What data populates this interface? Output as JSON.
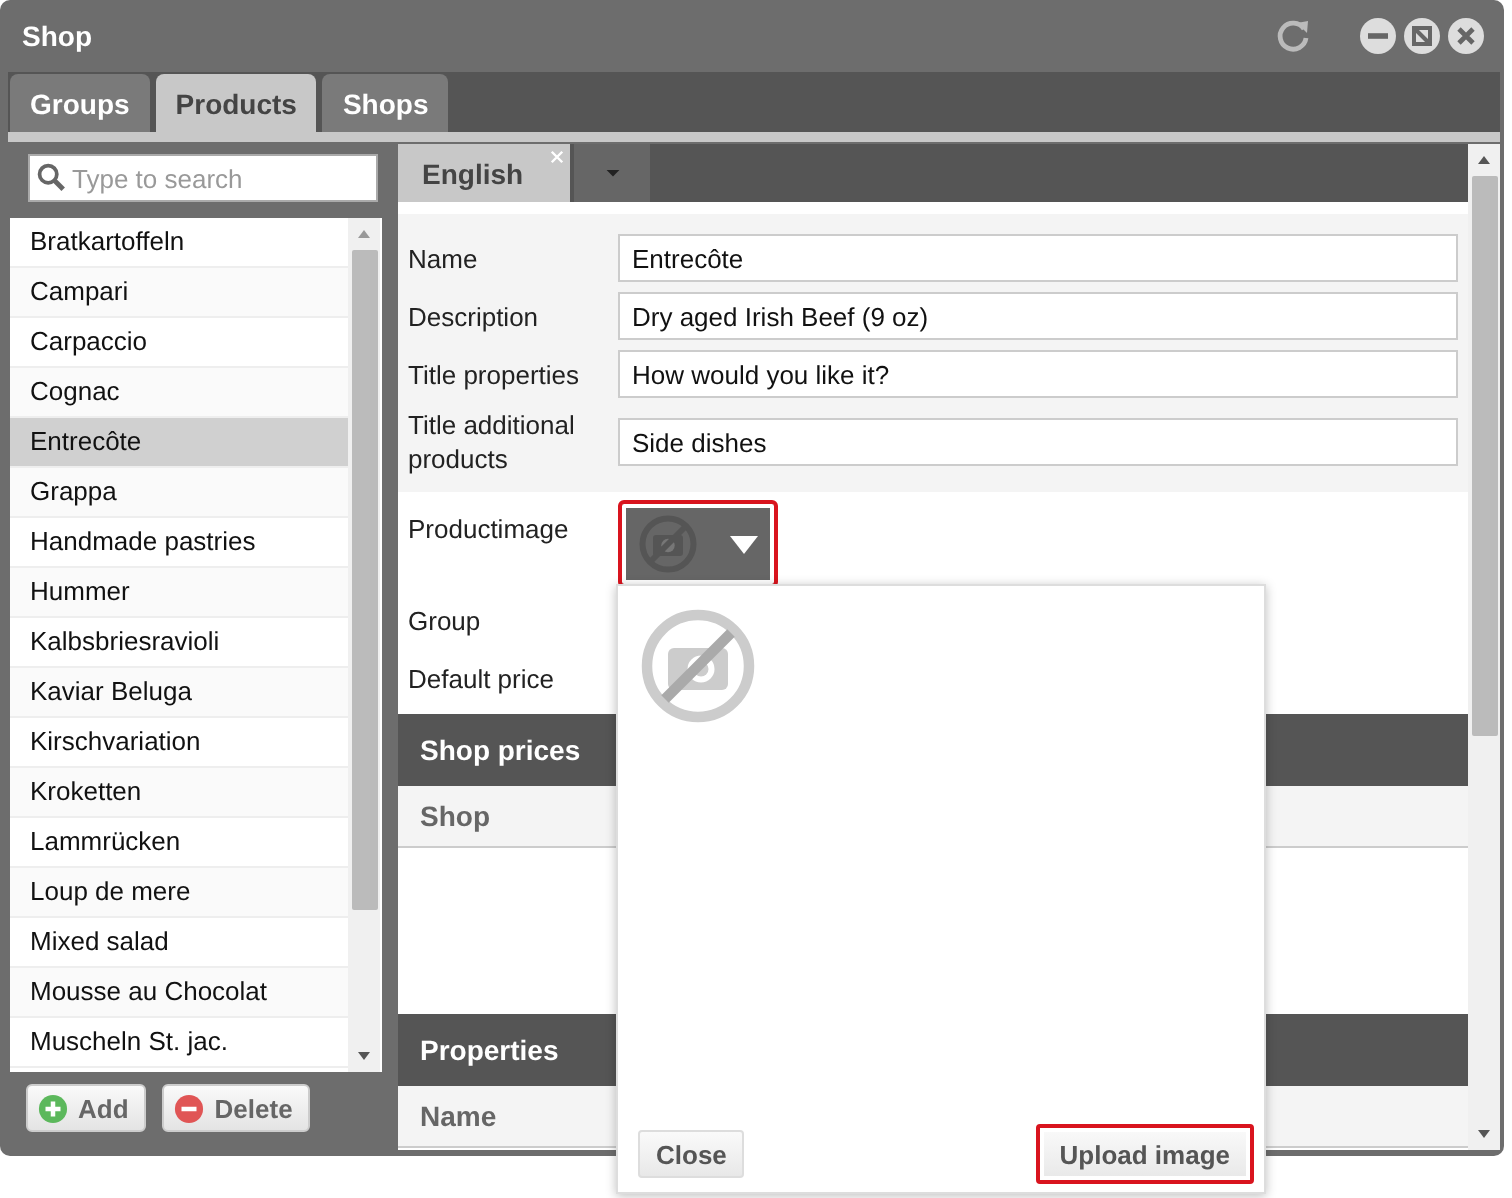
{
  "window": {
    "title": "Shop"
  },
  "tabs": [
    {
      "label": "Groups",
      "selected": false
    },
    {
      "label": "Products",
      "selected": true
    },
    {
      "label": "Shops",
      "selected": false
    }
  ],
  "search": {
    "placeholder": "Type to search"
  },
  "products": [
    {
      "name": "Bratkartoffeln",
      "selected": false
    },
    {
      "name": "Campari",
      "selected": false
    },
    {
      "name": "Carpaccio",
      "selected": false
    },
    {
      "name": "Cognac",
      "selected": false
    },
    {
      "name": "Entrecôte",
      "selected": true
    },
    {
      "name": "Grappa",
      "selected": false
    },
    {
      "name": "Handmade pastries",
      "selected": false
    },
    {
      "name": "Hummer",
      "selected": false
    },
    {
      "name": "Kalbsbriesravioli",
      "selected": false
    },
    {
      "name": "Kaviar Beluga",
      "selected": false
    },
    {
      "name": "Kirschvariation",
      "selected": false
    },
    {
      "name": "Kroketten",
      "selected": false
    },
    {
      "name": "Lammrücken",
      "selected": false
    },
    {
      "name": "Loup de mere",
      "selected": false
    },
    {
      "name": "Mixed salad",
      "selected": false
    },
    {
      "name": "Mousse au Chocolat",
      "selected": false
    },
    {
      "name": "Muscheln St. jac.",
      "selected": false
    }
  ],
  "list_buttons": [
    {
      "label": "Add",
      "kind": "add"
    },
    {
      "label": "Delete",
      "kind": "delete"
    }
  ],
  "language_tabs": [
    {
      "label": "English",
      "selected": true
    }
  ],
  "form": {
    "fields": [
      {
        "label": "Name",
        "value": "Entrecôte"
      },
      {
        "label": "Description",
        "value": "Dry aged Irish Beef (9 oz)"
      },
      {
        "label": "Title properties",
        "value": "How would you like it?"
      },
      {
        "label": "Title additional products",
        "value": "Side dishes"
      }
    ],
    "product_image": {
      "label": "Productimage",
      "highlighted": true
    },
    "other_labels": [
      "Group",
      "Default price"
    ]
  },
  "sections": [
    {
      "title": "Shop prices",
      "column": "Shop"
    },
    {
      "title": "Properties",
      "column": "Name"
    }
  ],
  "image_popup": {
    "buttons": [
      {
        "label": "Close",
        "highlighted": false
      },
      {
        "label": "Upload image",
        "highlighted": true
      }
    ]
  }
}
